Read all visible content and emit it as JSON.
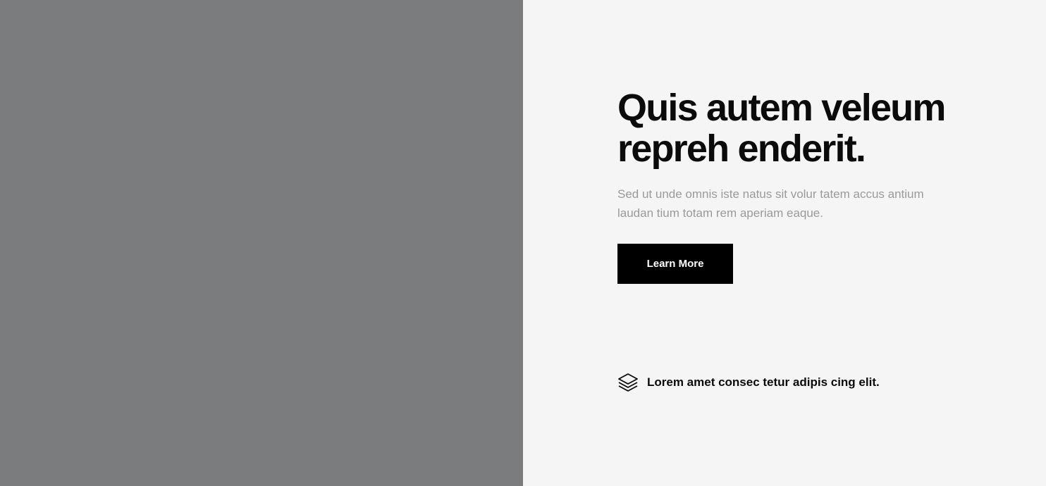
{
  "hero": {
    "headline": "Quis autem veleum repreh enderit.",
    "description": "Sed ut unde omnis iste natus sit volur tatem accus antium laudan tium totam rem aperiam eaque.",
    "button_label": "Learn More"
  },
  "feature": {
    "icon": "layers-icon",
    "text": "Lorem amet consec tetur adipis cing elit."
  },
  "colors": {
    "left_panel": "#7b7c7e",
    "right_panel": "#f5f5f5",
    "button_bg": "#000000",
    "button_text": "#ffffff",
    "headline": "#0b0b0b",
    "description": "#9a9a9a"
  }
}
